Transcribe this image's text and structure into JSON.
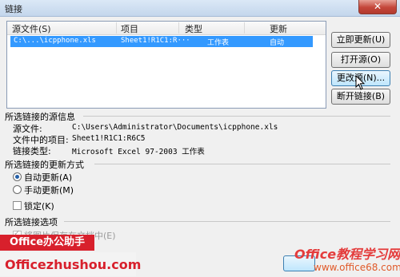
{
  "window": {
    "title": "链接",
    "close_glyph": "✕"
  },
  "list": {
    "columns": {
      "source": "源文件(S)",
      "item": "项目",
      "type": "类型",
      "update": "更新"
    },
    "rows": [
      {
        "source": "C:\\...\\icpphone.xls",
        "item": "Sheet1!R1C1:R···",
        "type": "工作表",
        "update": "自动"
      }
    ]
  },
  "buttons": {
    "update_now": "立即更新(U)",
    "open_source": "打开源(O)",
    "change_source": "更改源(N)...",
    "break_link": "断开链接(B)"
  },
  "source_info": {
    "heading": "所选链接的源信息",
    "file_label": "源文件:",
    "file_value": "C:\\Users\\Administrator\\Documents\\icpphone.xls",
    "item_label": "文件中的项目:",
    "item_value": "Sheet1!R1C1:R6C5",
    "type_label": "链接类型:",
    "type_value": "Microsoft Excel 97-2003 工作表"
  },
  "update_mode": {
    "heading": "所选链接的更新方式",
    "auto": "自动更新(A)",
    "manual": "手动更新(M)",
    "selected": "auto",
    "lock": "锁定(K)"
  },
  "options": {
    "heading": "所选链接选项",
    "save_picture": "将图片保存在文档中(E)"
  },
  "watermarks": {
    "badge": "Office办公助手",
    "site_left": "Officezhushou.com",
    "site_right_top": "Office教程学习网",
    "site_right_bottom": "www.office68.com"
  }
}
